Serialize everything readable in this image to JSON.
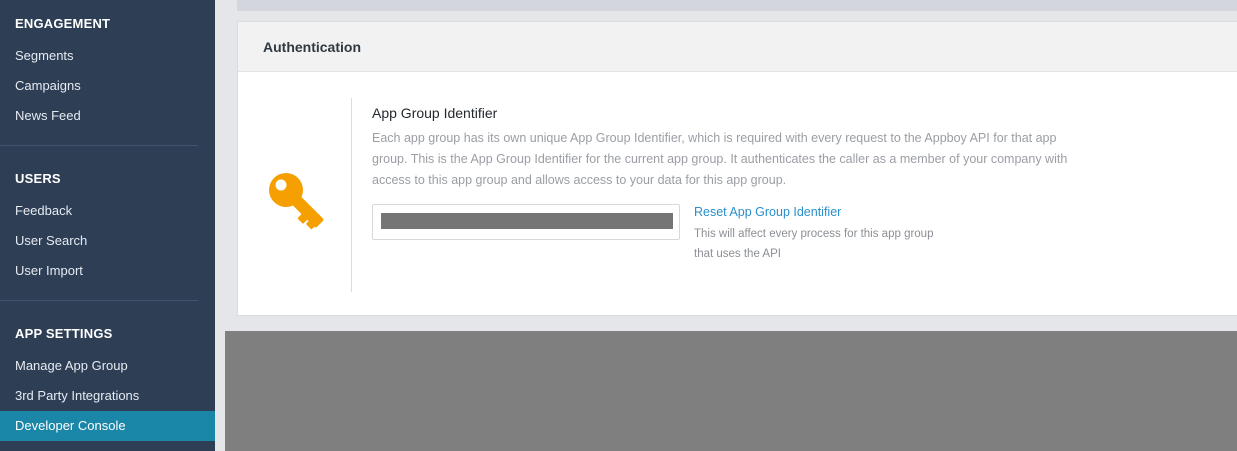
{
  "sidebar": {
    "sections": [
      {
        "title": "ENGAGEMENT",
        "items": [
          "Segments",
          "Campaigns",
          "News Feed"
        ]
      },
      {
        "title": "USERS",
        "items": [
          "Feedback",
          "User Search",
          "User Import"
        ]
      },
      {
        "title": "APP SETTINGS",
        "items": [
          "Manage App Group",
          "3rd Party Integrations",
          "Developer Console"
        ]
      }
    ],
    "active_item": "Developer Console"
  },
  "card": {
    "title": "Authentication",
    "icon": "key-icon",
    "heading": "App Group Identifier",
    "description": "Each app group has its own unique App Group Identifier, which is required with every request to the Appboy API for that app group. This is the App Group Identifier for the current app group. It authenticates the caller as a member of your company with access to this app group and allows access to your data for this app group.",
    "reset_link": "Reset App Group Identifier",
    "reset_note": "This will affect every process for this app group that uses the API"
  },
  "colors": {
    "sidebar_bg": "#2d3e55",
    "active_nav": "#1a86a8",
    "key_icon": "#f5a000",
    "link": "#2a8fca"
  }
}
